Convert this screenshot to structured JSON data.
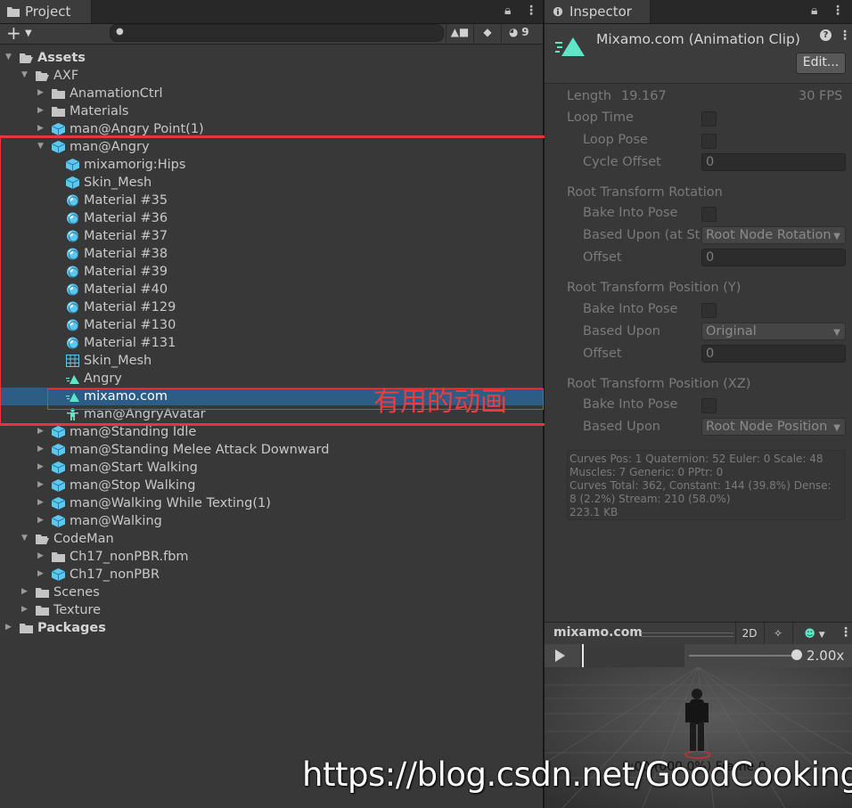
{
  "project": {
    "tab_label": "Project",
    "hidden_count": "9",
    "search_placeholder": "",
    "tree": [
      {
        "label": "Assets",
        "depth": 0,
        "arrow": "down",
        "icon": "folder-open",
        "bold": true
      },
      {
        "label": "AXF",
        "depth": 1,
        "arrow": "down",
        "icon": "folder-open"
      },
      {
        "label": "AnamationCtrl",
        "depth": 2,
        "arrow": "right",
        "icon": "folder"
      },
      {
        "label": "Materials",
        "depth": 2,
        "arrow": "right",
        "icon": "folder"
      },
      {
        "label": "man@Angry Point(1)",
        "depth": 2,
        "arrow": "right",
        "icon": "model"
      },
      {
        "label": "man@Angry",
        "depth": 2,
        "arrow": "down",
        "icon": "model"
      },
      {
        "label": "mixamorig:Hips",
        "depth": 3,
        "arrow": "",
        "icon": "model"
      },
      {
        "label": "Skin_Mesh",
        "depth": 3,
        "arrow": "",
        "icon": "model"
      },
      {
        "label": "Material #35",
        "depth": 3,
        "arrow": "",
        "icon": "material"
      },
      {
        "label": "Material #36",
        "depth": 3,
        "arrow": "",
        "icon": "material"
      },
      {
        "label": "Material #37",
        "depth": 3,
        "arrow": "",
        "icon": "material"
      },
      {
        "label": "Material #38",
        "depth": 3,
        "arrow": "",
        "icon": "material"
      },
      {
        "label": "Material #39",
        "depth": 3,
        "arrow": "",
        "icon": "material"
      },
      {
        "label": "Material #40",
        "depth": 3,
        "arrow": "",
        "icon": "material"
      },
      {
        "label": "Material #129",
        "depth": 3,
        "arrow": "",
        "icon": "material"
      },
      {
        "label": "Material #130",
        "depth": 3,
        "arrow": "",
        "icon": "material"
      },
      {
        "label": "Material #131",
        "depth": 3,
        "arrow": "",
        "icon": "material"
      },
      {
        "label": "Skin_Mesh",
        "depth": 3,
        "arrow": "",
        "icon": "mesh"
      },
      {
        "label": "Angry",
        "depth": 3,
        "arrow": "",
        "icon": "clip"
      },
      {
        "label": "mixamo.com",
        "depth": 3,
        "arrow": "",
        "icon": "clip",
        "selected": true
      },
      {
        "label": "man@AngryAvatar",
        "depth": 3,
        "arrow": "",
        "icon": "avatar"
      },
      {
        "label": "man@Standing Idle",
        "depth": 2,
        "arrow": "right",
        "icon": "model"
      },
      {
        "label": "man@Standing Melee Attack Downward",
        "depth": 2,
        "arrow": "right",
        "icon": "model"
      },
      {
        "label": "man@Start Walking",
        "depth": 2,
        "arrow": "right",
        "icon": "model"
      },
      {
        "label": "man@Stop Walking",
        "depth": 2,
        "arrow": "right",
        "icon": "model"
      },
      {
        "label": "man@Walking While Texting(1)",
        "depth": 2,
        "arrow": "right",
        "icon": "model"
      },
      {
        "label": "man@Walking",
        "depth": 2,
        "arrow": "right",
        "icon": "model"
      },
      {
        "label": "CodeMan",
        "depth": 1,
        "arrow": "down",
        "icon": "folder-open"
      },
      {
        "label": "Ch17_nonPBR.fbm",
        "depth": 2,
        "arrow": "right",
        "icon": "folder"
      },
      {
        "label": "Ch17_nonPBR",
        "depth": 2,
        "arrow": "right",
        "icon": "model"
      },
      {
        "label": "Scenes",
        "depth": 1,
        "arrow": "right",
        "icon": "folder"
      },
      {
        "label": "Texture",
        "depth": 1,
        "arrow": "right",
        "icon": "folder"
      },
      {
        "label": "Packages",
        "depth": 0,
        "arrow": "right",
        "icon": "folder",
        "bold": true
      }
    ],
    "annotation": "有用的动画"
  },
  "inspector": {
    "tab_label": "Inspector",
    "clip_title": "Mixamo.com (Animation Clip)",
    "edit_button": "Edit...",
    "length_label": "Length",
    "length_value": "19.167",
    "fps": "30 FPS",
    "loop_time": "Loop Time",
    "loop_pose": "Loop Pose",
    "cycle_offset": "Cycle Offset",
    "cycle_offset_value": "0",
    "rot_header": "Root Transform Rotation",
    "rot_bake": "Bake Into Pose",
    "rot_based": "Based Upon (at St",
    "rot_based_value": "Root Node Rotation",
    "rot_offset": "Offset",
    "rot_offset_value": "0",
    "posy_header": "Root Transform Position (Y)",
    "posy_bake": "Bake Into Pose",
    "posy_based": "Based Upon",
    "posy_based_value": "Original",
    "posy_offset": "Offset",
    "posy_offset_value": "0",
    "posxz_header": "Root Transform Position (XZ)",
    "posxz_bake": "Bake Into Pose",
    "posxz_based": "Based Upon",
    "posxz_based_value": "Root Node Position",
    "stats": [
      "Curves Pos: 1 Quaternion: 52 Euler: 0 Scale: 48",
      "Muscles: 7 Generic: 0 PPtr: 0",
      "Curves Total: 362, Constant: 144 (39.8%) Dense:",
      "8 (2.2%) Stream: 210 (58.0%)",
      "223.1 KB"
    ],
    "preview_title": "mixamo.com",
    "btn_2d": "2D",
    "speed": "2.00x",
    "frame_info": "0:00 (000.0%) Frame 0"
  },
  "watermark": "https://blog.csdn.net/GoodCooking",
  "colors": {
    "selection": "#2c5d87",
    "annotation": "#e8363a",
    "icon_blue": "#5cc8f0",
    "clip_teal": "#5ee6c8"
  }
}
